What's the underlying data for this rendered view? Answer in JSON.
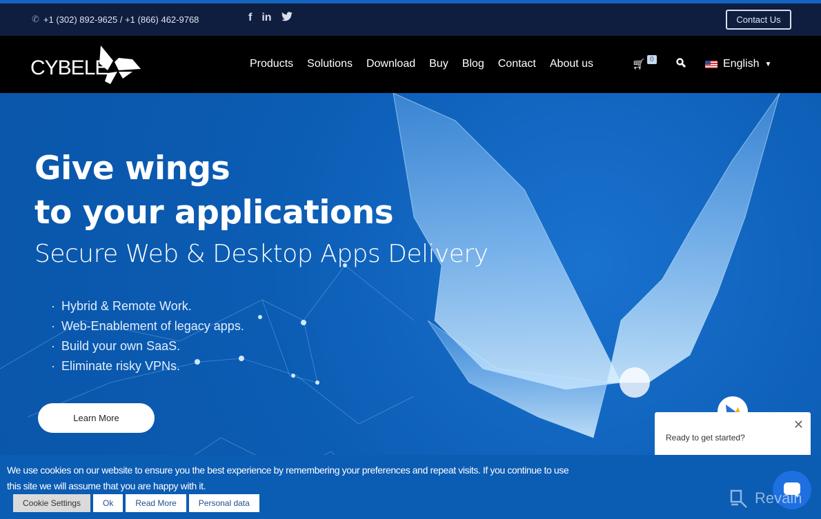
{
  "topbar": {
    "phone": "+1 (302) 892-9625 / +1 (866) 462-9768",
    "social": [
      {
        "icon": "facebook-icon",
        "glyph": "f"
      },
      {
        "icon": "linkedin-icon",
        "glyph": "in"
      },
      {
        "icon": "twitter-icon",
        "glyph": "🐦"
      }
    ],
    "contact_label": "Contact Us"
  },
  "nav": {
    "logo": "CYBELE",
    "items": [
      "Products",
      "Solutions",
      "Download",
      "Buy",
      "Blog",
      "Contact",
      "About us"
    ],
    "cart_count": "0",
    "language": "English"
  },
  "hero": {
    "title_line1": "Give wings",
    "title_line2": "to your applications",
    "subtitle": "Secure Web & Desktop Apps Delivery",
    "bullets": [
      "Hybrid & Remote Work.",
      "Web-Enablement of legacy apps.",
      "Build your own SaaS.",
      "Eliminate risky VPNs."
    ],
    "cta": "Learn More"
  },
  "cookie": {
    "text": "We use cookies on our website to ensure you the best experience by remembering your preferences and repeat visits. If you continue to use this site we will assume that you are happy with it.",
    "buttons": [
      "Cookie Settings",
      "Ok",
      "Read More",
      "Personal data"
    ]
  },
  "chat": {
    "text": "Ready to get started?"
  },
  "watermark": "Revain",
  "colors": {
    "hero_bg": "#0b5cb3",
    "topbar_bg": "#0f1d3f",
    "nav_bg": "#000000"
  }
}
